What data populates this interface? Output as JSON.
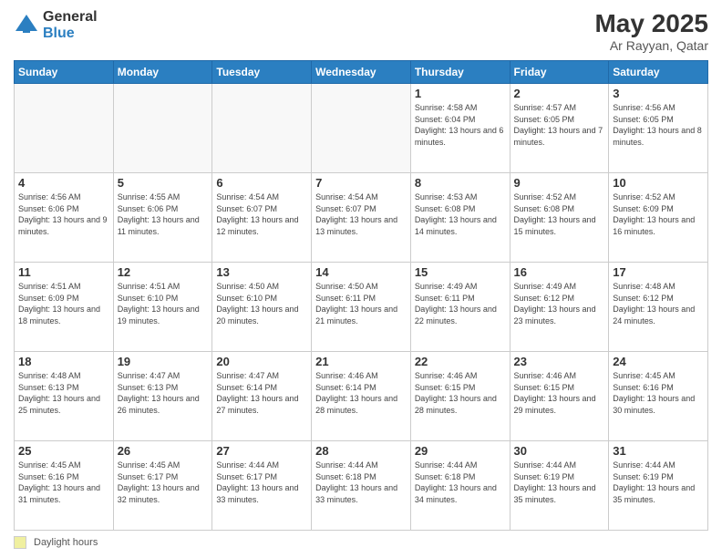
{
  "logo": {
    "general": "General",
    "blue": "Blue"
  },
  "header": {
    "title": "May 2025",
    "subtitle": "Ar Rayyan, Qatar"
  },
  "days_of_week": [
    "Sunday",
    "Monday",
    "Tuesday",
    "Wednesday",
    "Thursday",
    "Friday",
    "Saturday"
  ],
  "footer": {
    "legend_label": "Daylight hours"
  },
  "weeks": [
    [
      {
        "day": "",
        "info": ""
      },
      {
        "day": "",
        "info": ""
      },
      {
        "day": "",
        "info": ""
      },
      {
        "day": "",
        "info": ""
      },
      {
        "day": "1",
        "info": "Sunrise: 4:58 AM\nSunset: 6:04 PM\nDaylight: 13 hours\nand 6 minutes."
      },
      {
        "day": "2",
        "info": "Sunrise: 4:57 AM\nSunset: 6:05 PM\nDaylight: 13 hours\nand 7 minutes."
      },
      {
        "day": "3",
        "info": "Sunrise: 4:56 AM\nSunset: 6:05 PM\nDaylight: 13 hours\nand 8 minutes."
      }
    ],
    [
      {
        "day": "4",
        "info": "Sunrise: 4:56 AM\nSunset: 6:06 PM\nDaylight: 13 hours\nand 9 minutes."
      },
      {
        "day": "5",
        "info": "Sunrise: 4:55 AM\nSunset: 6:06 PM\nDaylight: 13 hours\nand 11 minutes."
      },
      {
        "day": "6",
        "info": "Sunrise: 4:54 AM\nSunset: 6:07 PM\nDaylight: 13 hours\nand 12 minutes."
      },
      {
        "day": "7",
        "info": "Sunrise: 4:54 AM\nSunset: 6:07 PM\nDaylight: 13 hours\nand 13 minutes."
      },
      {
        "day": "8",
        "info": "Sunrise: 4:53 AM\nSunset: 6:08 PM\nDaylight: 13 hours\nand 14 minutes."
      },
      {
        "day": "9",
        "info": "Sunrise: 4:52 AM\nSunset: 6:08 PM\nDaylight: 13 hours\nand 15 minutes."
      },
      {
        "day": "10",
        "info": "Sunrise: 4:52 AM\nSunset: 6:09 PM\nDaylight: 13 hours\nand 16 minutes."
      }
    ],
    [
      {
        "day": "11",
        "info": "Sunrise: 4:51 AM\nSunset: 6:09 PM\nDaylight: 13 hours\nand 18 minutes."
      },
      {
        "day": "12",
        "info": "Sunrise: 4:51 AM\nSunset: 6:10 PM\nDaylight: 13 hours\nand 19 minutes."
      },
      {
        "day": "13",
        "info": "Sunrise: 4:50 AM\nSunset: 6:10 PM\nDaylight: 13 hours\nand 20 minutes."
      },
      {
        "day": "14",
        "info": "Sunrise: 4:50 AM\nSunset: 6:11 PM\nDaylight: 13 hours\nand 21 minutes."
      },
      {
        "day": "15",
        "info": "Sunrise: 4:49 AM\nSunset: 6:11 PM\nDaylight: 13 hours\nand 22 minutes."
      },
      {
        "day": "16",
        "info": "Sunrise: 4:49 AM\nSunset: 6:12 PM\nDaylight: 13 hours\nand 23 minutes."
      },
      {
        "day": "17",
        "info": "Sunrise: 4:48 AM\nSunset: 6:12 PM\nDaylight: 13 hours\nand 24 minutes."
      }
    ],
    [
      {
        "day": "18",
        "info": "Sunrise: 4:48 AM\nSunset: 6:13 PM\nDaylight: 13 hours\nand 25 minutes."
      },
      {
        "day": "19",
        "info": "Sunrise: 4:47 AM\nSunset: 6:13 PM\nDaylight: 13 hours\nand 26 minutes."
      },
      {
        "day": "20",
        "info": "Sunrise: 4:47 AM\nSunset: 6:14 PM\nDaylight: 13 hours\nand 27 minutes."
      },
      {
        "day": "21",
        "info": "Sunrise: 4:46 AM\nSunset: 6:14 PM\nDaylight: 13 hours\nand 28 minutes."
      },
      {
        "day": "22",
        "info": "Sunrise: 4:46 AM\nSunset: 6:15 PM\nDaylight: 13 hours\nand 28 minutes."
      },
      {
        "day": "23",
        "info": "Sunrise: 4:46 AM\nSunset: 6:15 PM\nDaylight: 13 hours\nand 29 minutes."
      },
      {
        "day": "24",
        "info": "Sunrise: 4:45 AM\nSunset: 6:16 PM\nDaylight: 13 hours\nand 30 minutes."
      }
    ],
    [
      {
        "day": "25",
        "info": "Sunrise: 4:45 AM\nSunset: 6:16 PM\nDaylight: 13 hours\nand 31 minutes."
      },
      {
        "day": "26",
        "info": "Sunrise: 4:45 AM\nSunset: 6:17 PM\nDaylight: 13 hours\nand 32 minutes."
      },
      {
        "day": "27",
        "info": "Sunrise: 4:44 AM\nSunset: 6:17 PM\nDaylight: 13 hours\nand 33 minutes."
      },
      {
        "day": "28",
        "info": "Sunrise: 4:44 AM\nSunset: 6:18 PM\nDaylight: 13 hours\nand 33 minutes."
      },
      {
        "day": "29",
        "info": "Sunrise: 4:44 AM\nSunset: 6:18 PM\nDaylight: 13 hours\nand 34 minutes."
      },
      {
        "day": "30",
        "info": "Sunrise: 4:44 AM\nSunset: 6:19 PM\nDaylight: 13 hours\nand 35 minutes."
      },
      {
        "day": "31",
        "info": "Sunrise: 4:44 AM\nSunset: 6:19 PM\nDaylight: 13 hours\nand 35 minutes."
      }
    ]
  ]
}
